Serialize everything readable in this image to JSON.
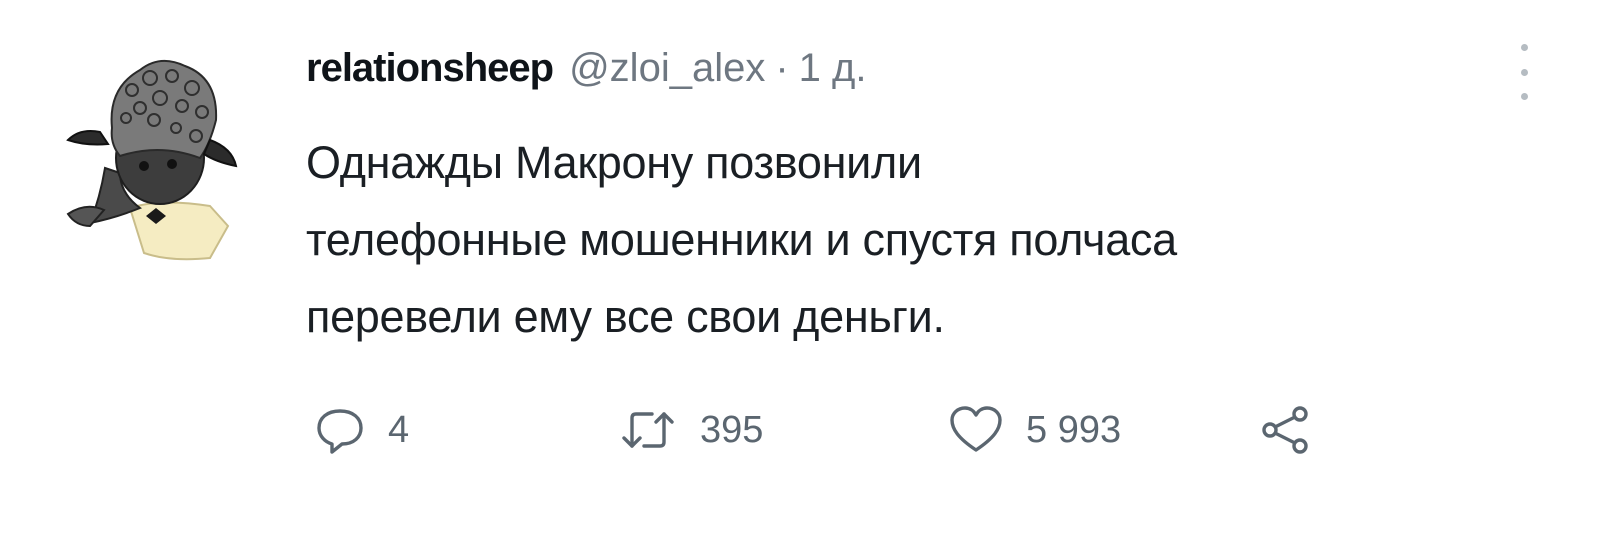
{
  "tweet": {
    "display_name": "relationsheep",
    "handle": "@zloi_alex",
    "separator": "·",
    "time": "1 д.",
    "text_lines": [
      "Однажды Макрону позвонили",
      "телефонные мошенники и спустя полчаса",
      "перевели ему все свои деньги."
    ],
    "actions": {
      "replies": "4",
      "retweets": "395",
      "likes": "5 993"
    }
  },
  "icons": {
    "reply": "speech-bubble-icon",
    "retweet": "retweet-arrows-icon",
    "like": "heart-icon",
    "share": "share-nodes-icon",
    "more": "vertical-dots-icon"
  },
  "colors": {
    "name": "#0f1419",
    "secondary": "#6e7781",
    "icon": "#5b6670",
    "avatar_accent": "#f5ecc2"
  }
}
